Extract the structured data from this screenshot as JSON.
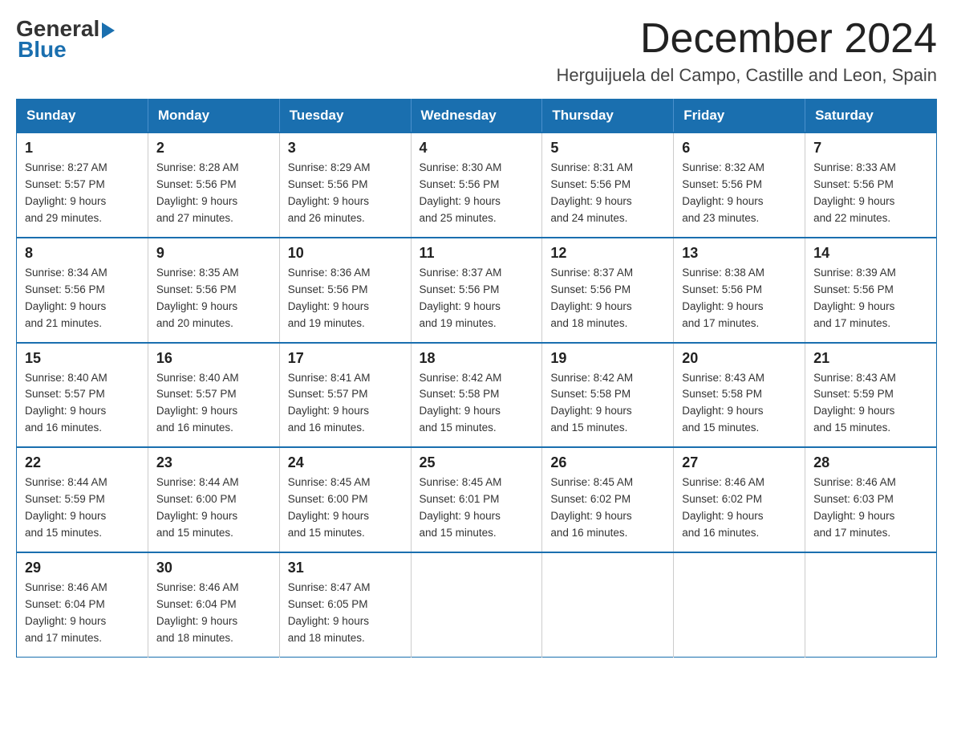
{
  "header": {
    "logo_general": "General",
    "logo_blue": "Blue",
    "month_title": "December 2024",
    "location": "Herguijuela del Campo, Castille and Leon, Spain"
  },
  "days_of_week": [
    "Sunday",
    "Monday",
    "Tuesday",
    "Wednesday",
    "Thursday",
    "Friday",
    "Saturday"
  ],
  "weeks": [
    [
      {
        "day": "1",
        "sunrise": "8:27 AM",
        "sunset": "5:57 PM",
        "daylight": "9 hours and 29 minutes."
      },
      {
        "day": "2",
        "sunrise": "8:28 AM",
        "sunset": "5:56 PM",
        "daylight": "9 hours and 27 minutes."
      },
      {
        "day": "3",
        "sunrise": "8:29 AM",
        "sunset": "5:56 PM",
        "daylight": "9 hours and 26 minutes."
      },
      {
        "day": "4",
        "sunrise": "8:30 AM",
        "sunset": "5:56 PM",
        "daylight": "9 hours and 25 minutes."
      },
      {
        "day": "5",
        "sunrise": "8:31 AM",
        "sunset": "5:56 PM",
        "daylight": "9 hours and 24 minutes."
      },
      {
        "day": "6",
        "sunrise": "8:32 AM",
        "sunset": "5:56 PM",
        "daylight": "9 hours and 23 minutes."
      },
      {
        "day": "7",
        "sunrise": "8:33 AM",
        "sunset": "5:56 PM",
        "daylight": "9 hours and 22 minutes."
      }
    ],
    [
      {
        "day": "8",
        "sunrise": "8:34 AM",
        "sunset": "5:56 PM",
        "daylight": "9 hours and 21 minutes."
      },
      {
        "day": "9",
        "sunrise": "8:35 AM",
        "sunset": "5:56 PM",
        "daylight": "9 hours and 20 minutes."
      },
      {
        "day": "10",
        "sunrise": "8:36 AM",
        "sunset": "5:56 PM",
        "daylight": "9 hours and 19 minutes."
      },
      {
        "day": "11",
        "sunrise": "8:37 AM",
        "sunset": "5:56 PM",
        "daylight": "9 hours and 19 minutes."
      },
      {
        "day": "12",
        "sunrise": "8:37 AM",
        "sunset": "5:56 PM",
        "daylight": "9 hours and 18 minutes."
      },
      {
        "day": "13",
        "sunrise": "8:38 AM",
        "sunset": "5:56 PM",
        "daylight": "9 hours and 17 minutes."
      },
      {
        "day": "14",
        "sunrise": "8:39 AM",
        "sunset": "5:56 PM",
        "daylight": "9 hours and 17 minutes."
      }
    ],
    [
      {
        "day": "15",
        "sunrise": "8:40 AM",
        "sunset": "5:57 PM",
        "daylight": "9 hours and 16 minutes."
      },
      {
        "day": "16",
        "sunrise": "8:40 AM",
        "sunset": "5:57 PM",
        "daylight": "9 hours and 16 minutes."
      },
      {
        "day": "17",
        "sunrise": "8:41 AM",
        "sunset": "5:57 PM",
        "daylight": "9 hours and 16 minutes."
      },
      {
        "day": "18",
        "sunrise": "8:42 AM",
        "sunset": "5:58 PM",
        "daylight": "9 hours and 15 minutes."
      },
      {
        "day": "19",
        "sunrise": "8:42 AM",
        "sunset": "5:58 PM",
        "daylight": "9 hours and 15 minutes."
      },
      {
        "day": "20",
        "sunrise": "8:43 AM",
        "sunset": "5:58 PM",
        "daylight": "9 hours and 15 minutes."
      },
      {
        "day": "21",
        "sunrise": "8:43 AM",
        "sunset": "5:59 PM",
        "daylight": "9 hours and 15 minutes."
      }
    ],
    [
      {
        "day": "22",
        "sunrise": "8:44 AM",
        "sunset": "5:59 PM",
        "daylight": "9 hours and 15 minutes."
      },
      {
        "day": "23",
        "sunrise": "8:44 AM",
        "sunset": "6:00 PM",
        "daylight": "9 hours and 15 minutes."
      },
      {
        "day": "24",
        "sunrise": "8:45 AM",
        "sunset": "6:00 PM",
        "daylight": "9 hours and 15 minutes."
      },
      {
        "day": "25",
        "sunrise": "8:45 AM",
        "sunset": "6:01 PM",
        "daylight": "9 hours and 15 minutes."
      },
      {
        "day": "26",
        "sunrise": "8:45 AM",
        "sunset": "6:02 PM",
        "daylight": "9 hours and 16 minutes."
      },
      {
        "day": "27",
        "sunrise": "8:46 AM",
        "sunset": "6:02 PM",
        "daylight": "9 hours and 16 minutes."
      },
      {
        "day": "28",
        "sunrise": "8:46 AM",
        "sunset": "6:03 PM",
        "daylight": "9 hours and 17 minutes."
      }
    ],
    [
      {
        "day": "29",
        "sunrise": "8:46 AM",
        "sunset": "6:04 PM",
        "daylight": "9 hours and 17 minutes."
      },
      {
        "day": "30",
        "sunrise": "8:46 AM",
        "sunset": "6:04 PM",
        "daylight": "9 hours and 18 minutes."
      },
      {
        "day": "31",
        "sunrise": "8:47 AM",
        "sunset": "6:05 PM",
        "daylight": "9 hours and 18 minutes."
      },
      null,
      null,
      null,
      null
    ]
  ],
  "labels": {
    "sunrise_prefix": "Sunrise: ",
    "sunset_prefix": "Sunset: ",
    "daylight_prefix": "Daylight: "
  }
}
